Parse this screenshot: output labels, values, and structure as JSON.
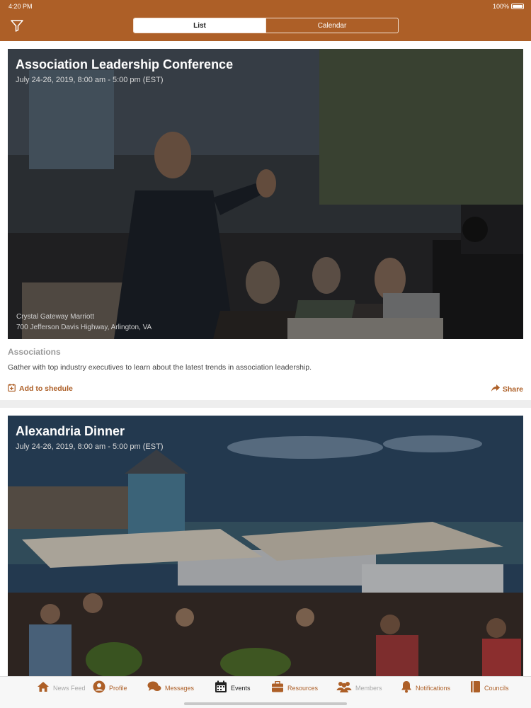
{
  "status_bar": {
    "time": "4:20 PM",
    "battery": "100%"
  },
  "header": {
    "segments": [
      {
        "label": "List",
        "active": true
      },
      {
        "label": "Calendar",
        "active": false
      }
    ]
  },
  "events": [
    {
      "title": "Association Leadership Conference",
      "date": "July 24-26, 2019, 8:00 am - 5:00 pm (EST)",
      "venue": "Crystal Gateway Marriott",
      "address": "700 Jefferson Davis Highway, Arlington, VA",
      "category": "Associations",
      "description": "Gather with top industry executives to learn about the latest trends in association leadership.",
      "add_label": "Add to shedule",
      "share_label": "Share"
    },
    {
      "title": "Alexandria Dinner",
      "date": "July 24-26, 2019, 8:00 am - 5:00 pm (EST)"
    }
  ],
  "tabbar": {
    "items": [
      {
        "label": "News Feed",
        "icon": "home-icon"
      },
      {
        "label": "Profile",
        "icon": "person-icon"
      },
      {
        "label": "Messages",
        "icon": "chat-bubbles-icon"
      },
      {
        "label": "Events",
        "icon": "calendar-icon"
      },
      {
        "label": "Resources",
        "icon": "briefcase-icon"
      },
      {
        "label": "Members",
        "icon": "people-icon"
      },
      {
        "label": "Notifications",
        "icon": "bell-icon"
      },
      {
        "label": "Councils",
        "icon": "book-icon"
      }
    ]
  },
  "colors": {
    "brand": "#ad5f27",
    "muted": "#a8a8a8",
    "active_tab": "#222222"
  }
}
